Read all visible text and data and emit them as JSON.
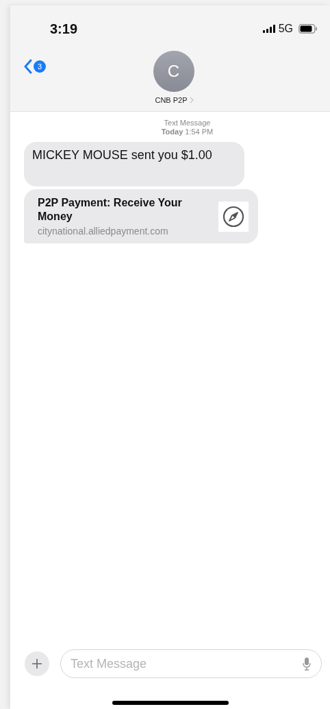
{
  "status_bar": {
    "time": "3:19",
    "network": "5G"
  },
  "header": {
    "back_badge": "3",
    "contact": {
      "initial": "C",
      "name": "CNB P2P"
    }
  },
  "thread": {
    "service": "Text Message",
    "timestamp": "**Today** 1:54 PM",
    "messages": [
      {
        "kind": "text",
        "text": "MICKEY MOUSE sent you $1.00"
      },
      {
        "kind": "link",
        "title": "P2P Payment: Receive Your Money",
        "domain": "citynational.alliedpayment.com"
      }
    ]
  },
  "composer": {
    "placeholder": "Text Message"
  }
}
